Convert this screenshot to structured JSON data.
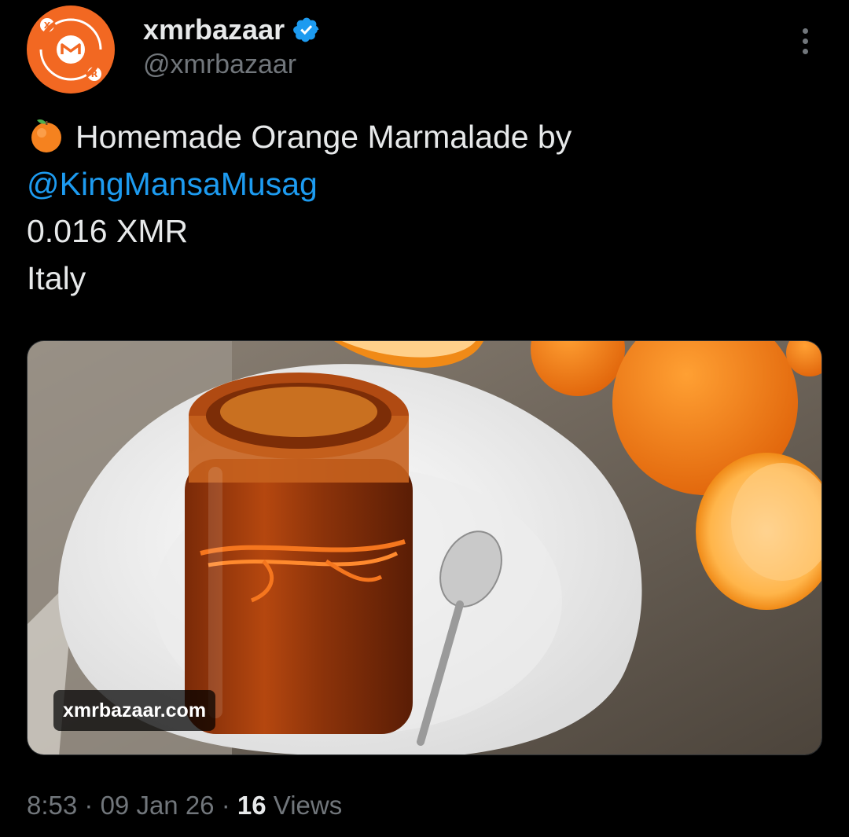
{
  "author": {
    "display_name": "xmrbazaar",
    "handle": "@xmrbazaar",
    "verified": true,
    "avatar_icon": "xmrbazaar-logo",
    "avatar_color": "#f26822"
  },
  "tweet": {
    "emoji": "tangerine-emoji",
    "line1": "Homemade Orange Marmalade by",
    "mention": "@KingMansaMusag",
    "price": "0.016 XMR",
    "location": "Italy"
  },
  "media": {
    "domain_label": "xmrbazaar.com",
    "description_icon": "marmalade-photo"
  },
  "meta": {
    "time": "8:53",
    "date": "09 Jan 26",
    "views_count": "16",
    "views_label": "Views",
    "separator": "·"
  },
  "colors": {
    "background": "#000000",
    "text": "#e7e9ea",
    "secondary": "#71767b",
    "link": "#1d9bf0",
    "verified": "#1d9bf0"
  }
}
